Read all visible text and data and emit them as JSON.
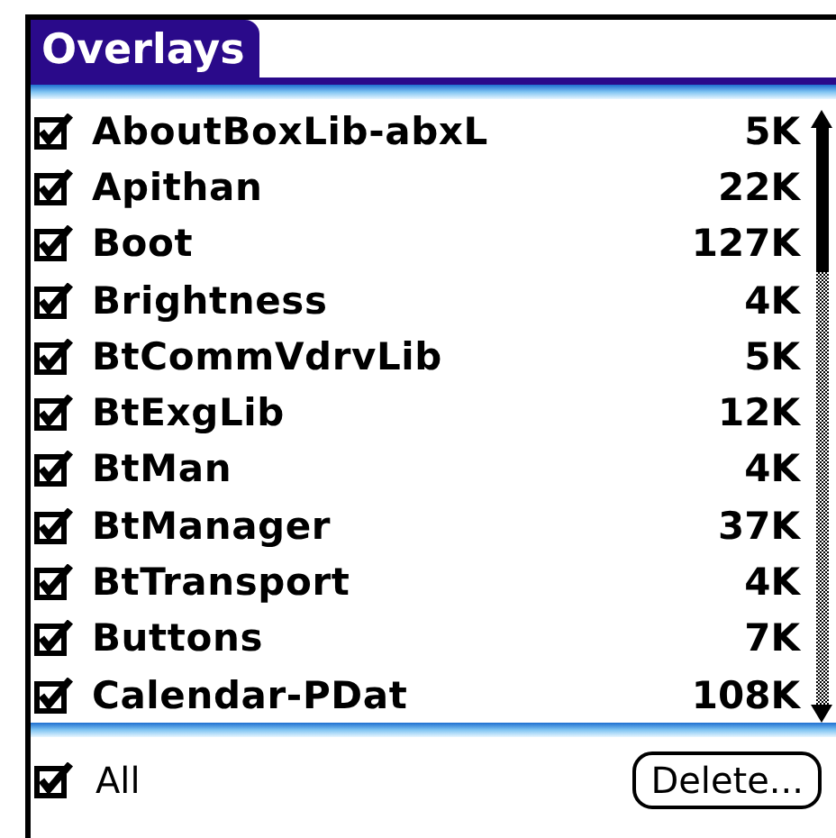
{
  "title": "Overlays",
  "items": [
    {
      "name": "AboutBoxLib-abxL",
      "size": "5K",
      "checked": true
    },
    {
      "name": "Apithan",
      "size": "22K",
      "checked": true
    },
    {
      "name": "Boot",
      "size": "127K",
      "checked": true
    },
    {
      "name": "Brightness",
      "size": "4K",
      "checked": true
    },
    {
      "name": "BtCommVdrvLib",
      "size": "5K",
      "checked": true
    },
    {
      "name": "BtExgLib",
      "size": "12K",
      "checked": true
    },
    {
      "name": "BtMan",
      "size": "4K",
      "checked": true
    },
    {
      "name": "BtManager",
      "size": "37K",
      "checked": true
    },
    {
      "name": "BtTransport",
      "size": "4K",
      "checked": true
    },
    {
      "name": "Buttons",
      "size": "7K",
      "checked": true
    },
    {
      "name": "Calendar-PDat",
      "size": "108K",
      "checked": true
    }
  ],
  "all": {
    "label": "All",
    "checked": true
  },
  "delete_button": "Delete..."
}
